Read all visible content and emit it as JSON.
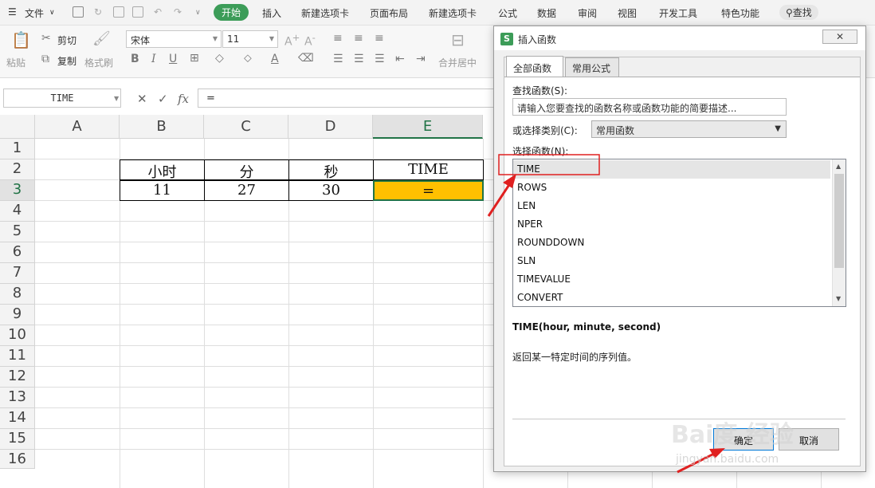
{
  "menubar": {
    "file": "文件",
    "tabs": [
      "开始",
      "插入",
      "新建选项卡",
      "页面布局",
      "新建选项卡",
      "公式",
      "数据",
      "审阅",
      "视图",
      "开发工具",
      "特色功能"
    ],
    "active_tab": "开始",
    "search": "查找"
  },
  "ribbon": {
    "paste": "粘贴",
    "cut": "剪切",
    "copy": "复制",
    "format_painter": "格式刷",
    "font_name": "宋体",
    "font_size": "11",
    "merge_center": "合并居中"
  },
  "formula_bar": {
    "name_box": "TIME",
    "fx": "fx",
    "formula": "="
  },
  "sheet": {
    "columns": [
      "A",
      "B",
      "C",
      "D",
      "E"
    ],
    "rows": [
      "1",
      "2",
      "3",
      "4",
      "5",
      "6",
      "7",
      "8",
      "9",
      "10",
      "11",
      "12",
      "13",
      "14",
      "15",
      "16"
    ],
    "headers": [
      "小时",
      "分",
      "秒",
      "TIME"
    ],
    "values": [
      "11",
      "27",
      "30",
      "="
    ],
    "active_cell": "E3",
    "active_fill": "#ffc000"
  },
  "dialog": {
    "title": "插入函数",
    "tabs": [
      "全部函数",
      "常用公式"
    ],
    "search_label": "查找函数(S):",
    "search_placeholder": "请输入您要查找的函数名称或函数功能的简要描述...",
    "category_label": "或选择类别(C):",
    "category_value": "常用函数",
    "list_label": "选择函数(N):",
    "functions": [
      "TIME",
      "ROWS",
      "LEN",
      "NPER",
      "ROUNDDOWN",
      "SLN",
      "TIMEVALUE",
      "CONVERT"
    ],
    "selected_function": "TIME",
    "signature": "TIME(hour, minute, second)",
    "description": "返回某一特定时间的序列值。",
    "ok": "确定",
    "cancel": "取消"
  },
  "watermark": {
    "brand": "Bai度 经验",
    "url": "jingyan.baidu.com"
  },
  "colors": {
    "accent_green": "#217346",
    "wps_green": "#3c9c58",
    "annotation_red": "#e02020"
  }
}
